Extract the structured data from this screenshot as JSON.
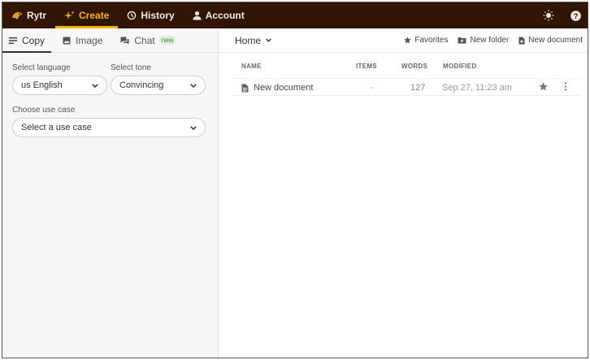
{
  "nav": {
    "logo": "Rytr",
    "items": [
      {
        "label": "Create",
        "icon": "sparkle-icon"
      },
      {
        "label": "History",
        "icon": "history-icon"
      },
      {
        "label": "Account",
        "icon": "person-icon"
      }
    ],
    "right_icons": [
      "sun-icon",
      "help-icon"
    ],
    "accent": "#f2b705",
    "background": "#2f1502"
  },
  "left": {
    "tabs": [
      {
        "label": "Copy",
        "icon": "lines-icon"
      },
      {
        "label": "Image",
        "icon": "image-icon"
      },
      {
        "label": "Chat",
        "icon": "chat-icon",
        "badge": "new"
      }
    ],
    "language": {
      "label": "Select language",
      "value": "us English"
    },
    "tone": {
      "label": "Select tone",
      "value": "Convincing"
    },
    "use_case": {
      "label": "Choose use case",
      "placeholder": "Select a use case"
    }
  },
  "right": {
    "breadcrumb": "Home",
    "actions": [
      {
        "label": "Favorites",
        "icon": "star-icon"
      },
      {
        "label": "New folder",
        "icon": "folder-plus-icon"
      },
      {
        "label": "New document",
        "icon": "document-plus-icon"
      }
    ],
    "columns": {
      "name": "NAME",
      "items": "ITEMS",
      "words": "WORDS",
      "modified": "MODIFIED"
    },
    "rows": [
      {
        "name": "New document",
        "items": "-",
        "words": "127",
        "modified": "Sep 27, 11:23 am"
      }
    ]
  }
}
